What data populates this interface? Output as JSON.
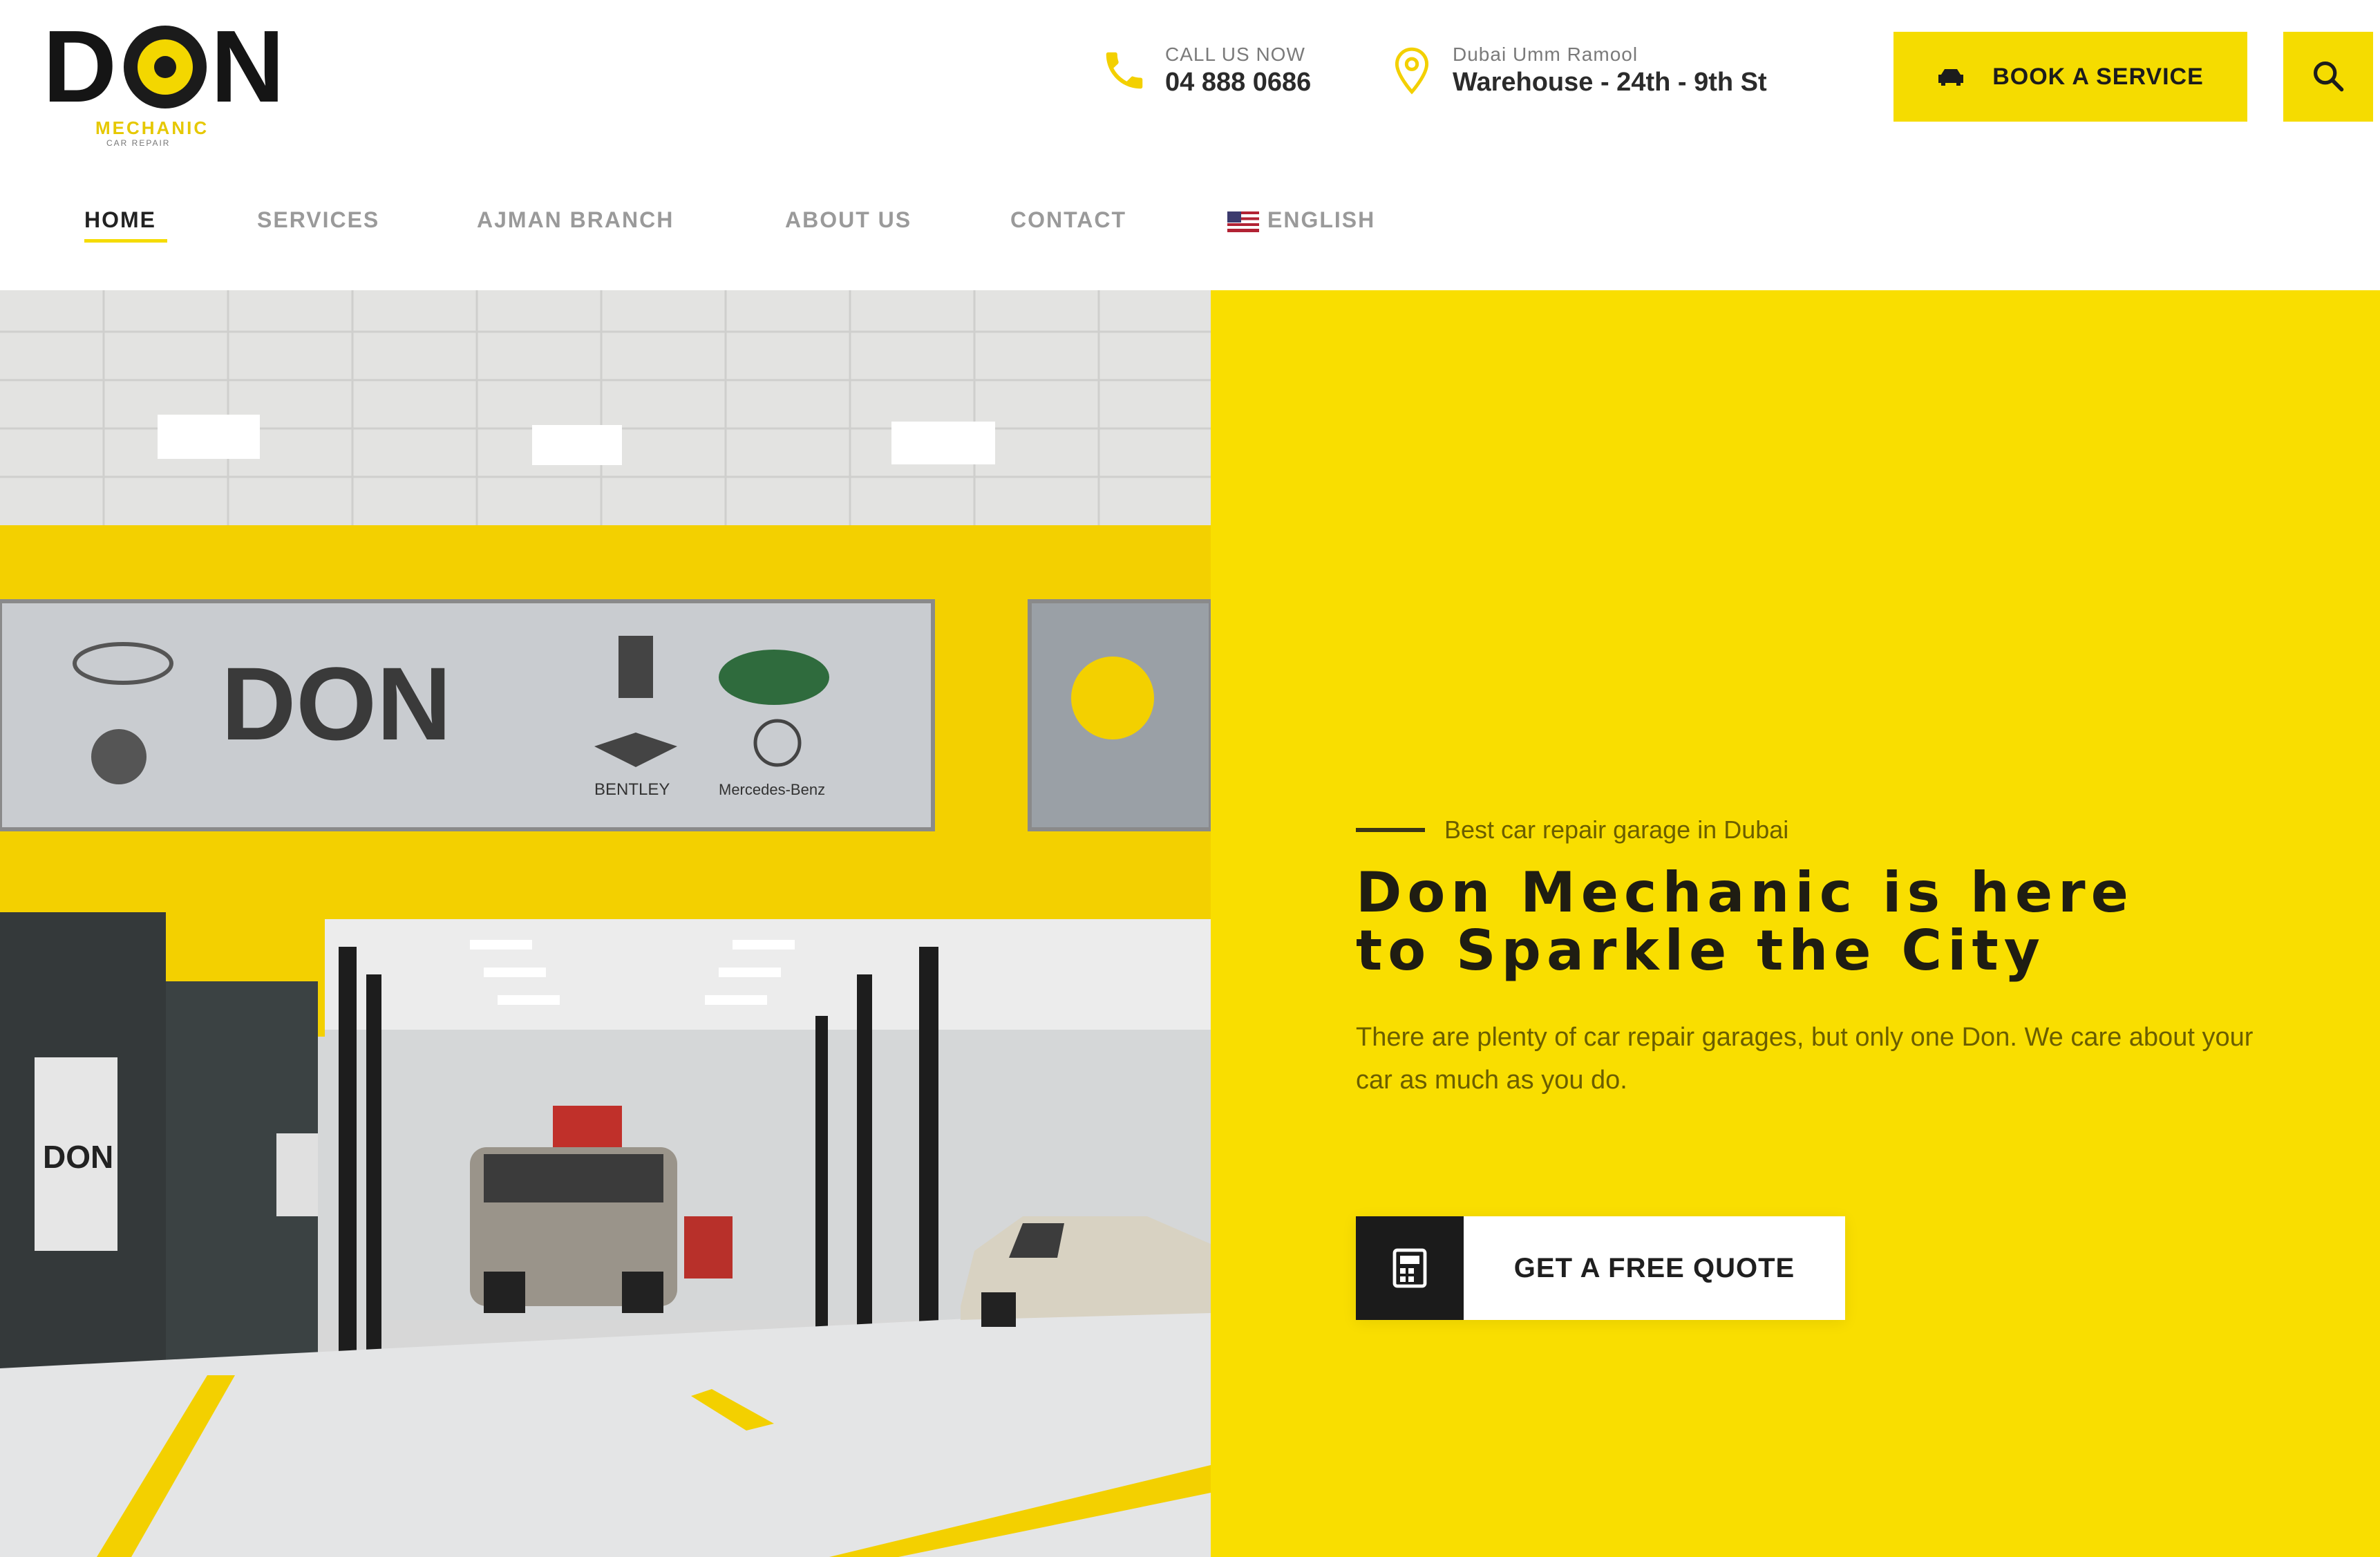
{
  "brand": {
    "logo_text": "DON",
    "logo_sub": "MECHANIC",
    "logo_tag": "CAR REPAIR"
  },
  "contact": {
    "phone_label": "CALL US NOW",
    "phone_value": "04 888 0686",
    "address_label": "Dubai Umm Ramool",
    "address_value": "Warehouse - 24th - 9th St"
  },
  "header": {
    "book_label": "BOOK A SERVICE",
    "search_icon": "search-icon"
  },
  "nav": {
    "items": [
      "HOME",
      "SERVICES",
      "AJMAN BRANCH",
      "ABOUT US",
      "CONTACT"
    ],
    "language": "ENGLISH",
    "active": "HOME"
  },
  "hero": {
    "eyebrow": "Best car repair garage in Dubai",
    "headline_line1": "Don Mechanic is here",
    "headline_line2": "to Sparkle the City",
    "description": "There are plenty of car repair garages, but only one Don. We care about your car as much as you do.",
    "cta_label": "GET A FREE QUOTE"
  },
  "image_text": {
    "wall_logo": "DON",
    "brand_badges": [
      "BENTLEY",
      "Mercedes-Benz"
    ],
    "door_logo": "DON"
  },
  "colors": {
    "accent": "#f5dc00",
    "panel": "#f9de00",
    "dark": "#1b1b1b"
  }
}
